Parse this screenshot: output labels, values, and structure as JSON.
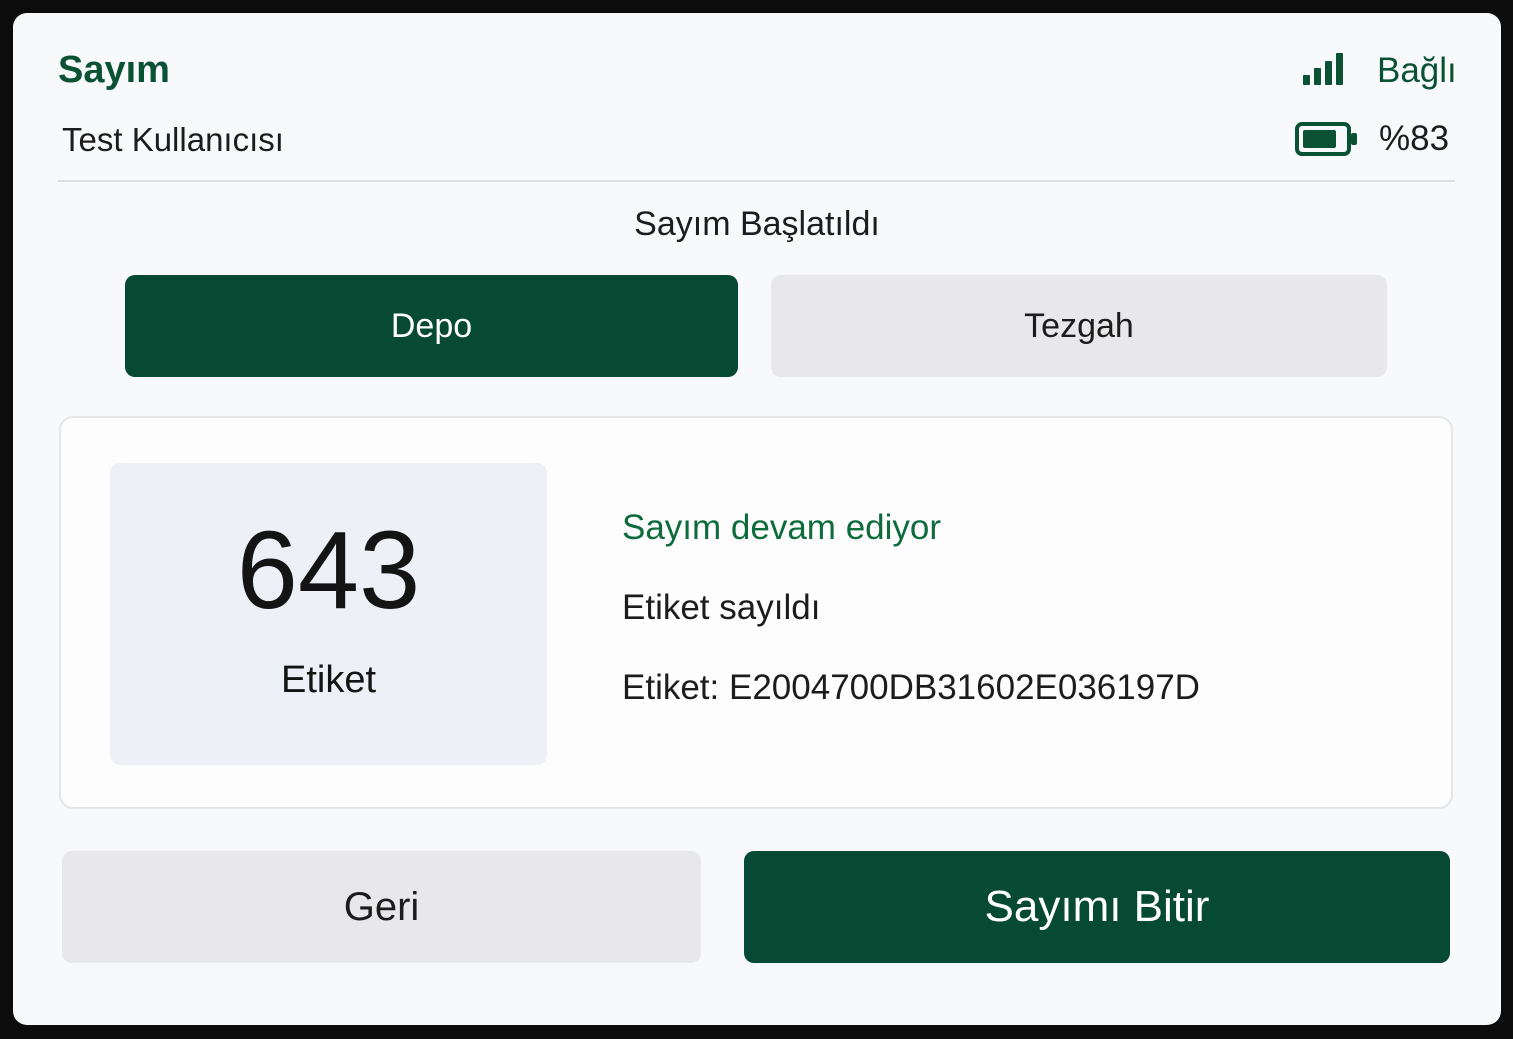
{
  "header": {
    "title": "Sayım",
    "user": "Test Kullanıcısı",
    "connection": {
      "icon": "signal-bars-icon",
      "label": "Bağlı"
    },
    "battery": {
      "icon": "battery-icon",
      "label": "%83",
      "level": 0.83
    }
  },
  "status_message": "Sayım Başlatıldı",
  "tabs": [
    {
      "label": "Depo",
      "active": true
    },
    {
      "label": "Tezgah",
      "active": false
    }
  ],
  "counter": {
    "value": "643",
    "label": "Etiket"
  },
  "info": {
    "progress": "Sayım devam ediyor",
    "last_event": "Etiket sayıldı",
    "last_tag": "Etiket: E2004700DB31602E036197D"
  },
  "actions": {
    "back_label": "Geri",
    "finish_label": "Sayımı Bitir"
  },
  "colors": {
    "brand": "#064a33",
    "accent_text": "#0e6b3c",
    "neutral_button": "#e8e8ea",
    "counter_bg": "#edf0f7"
  }
}
